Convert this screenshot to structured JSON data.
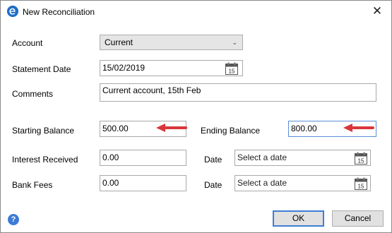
{
  "window": {
    "title": "New Reconciliation",
    "close_glyph": "✕"
  },
  "form": {
    "account_label": "Account",
    "account_value": "Current",
    "statement_date_label": "Statement Date",
    "statement_date_value": "15/02/2019",
    "comments_label": "Comments",
    "comments_value": "Current account, 15th Feb",
    "starting_balance_label": "Starting Balance",
    "starting_balance_value": "500.00",
    "ending_balance_label": "Ending Balance",
    "ending_balance_value": "800.00",
    "interest_received_label": "Interest Received",
    "interest_received_value": "0.00",
    "bank_fees_label": "Bank Fees",
    "bank_fees_value": "0.00",
    "date_label": "Date",
    "date_placeholder": "Select a date",
    "calendar_day": "15"
  },
  "footer": {
    "help_glyph": "?",
    "ok_label": "OK",
    "cancel_label": "Cancel"
  },
  "colors": {
    "accent": "#1e6ec8",
    "arrow": "#d9363b",
    "focus_border": "#5a8ed8"
  },
  "icons": [
    "app-logo-icon",
    "close-icon",
    "chevron-down-icon",
    "calendar-icon",
    "help-icon",
    "red-arrow-annotation"
  ]
}
